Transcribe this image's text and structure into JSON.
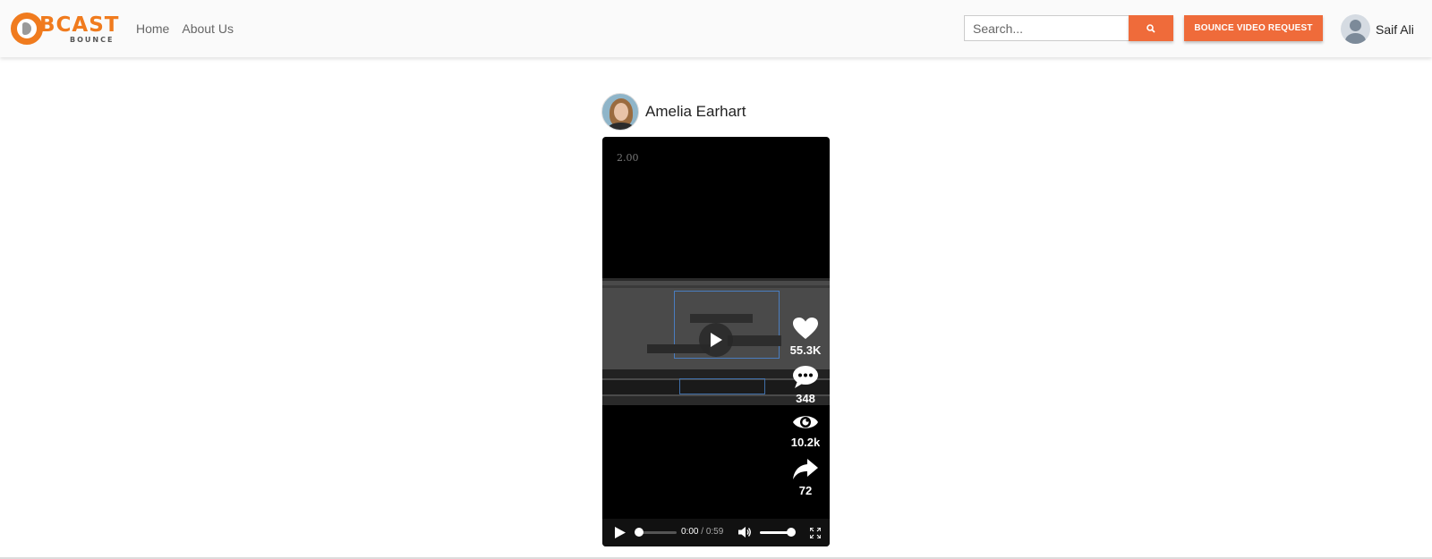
{
  "navbar": {
    "logo": {
      "main": "BCAST",
      "sub": "BOUNCE"
    },
    "links": [
      {
        "label": "Home"
      },
      {
        "label": "About Us"
      }
    ],
    "search": {
      "placeholder": "Search..."
    },
    "request_button": "BOUNCE VIDEO REQUEST",
    "user": {
      "name": "Saif Ali"
    }
  },
  "post": {
    "author": {
      "name": "Amelia Earhart"
    },
    "video": {
      "overlay_label": "2.00",
      "current_time": "0:00",
      "duration": "0:59",
      "progress_fraction": 0,
      "volume_fraction": 1
    },
    "stats": {
      "likes": "55.3K",
      "comments": "348",
      "views": "10.2k",
      "shares": "72"
    }
  },
  "colors": {
    "accent": "#ef6b3a",
    "logo_orange": "#f07b1e",
    "navbar_bg": "#fafafa",
    "video_bg": "#000000"
  },
  "icons": {
    "search": "search-icon",
    "like": "heart-icon",
    "comment": "comment-icon",
    "view": "eye-icon",
    "share": "share-icon",
    "play": "play-icon",
    "volume": "volume-icon",
    "fullscreen": "fullscreen-icon"
  }
}
